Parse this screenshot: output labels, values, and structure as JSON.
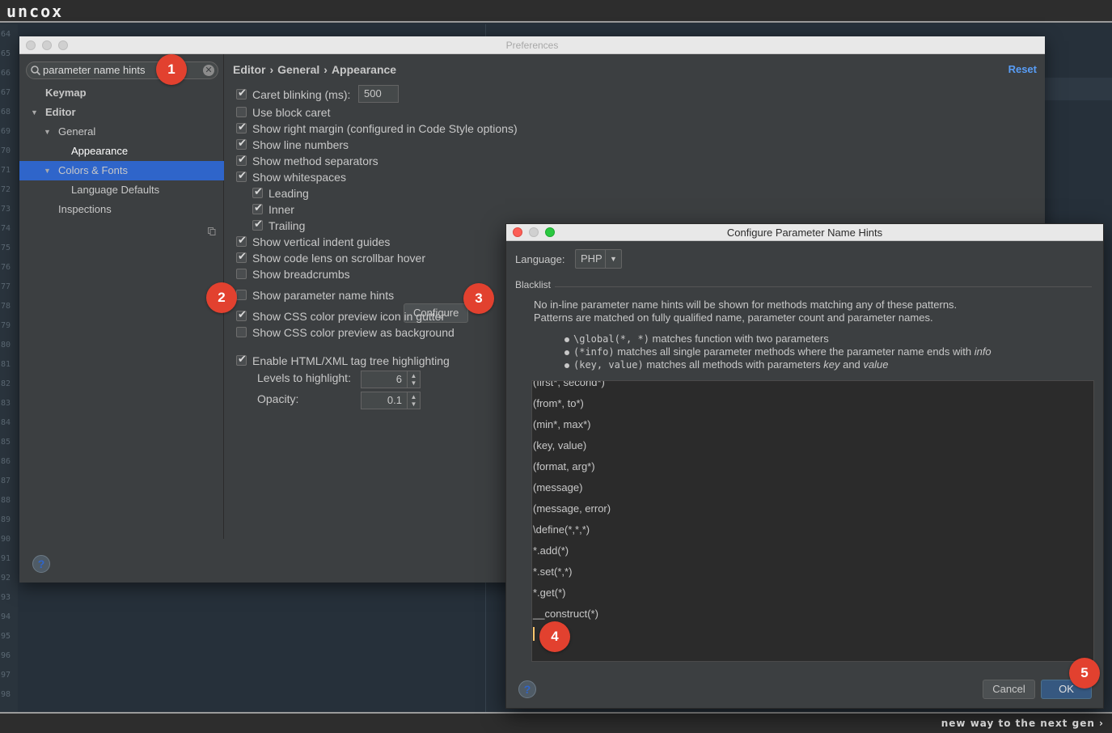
{
  "brand": "uncox",
  "tagline": "new way to the next gen",
  "gutter_lines": [
    "64",
    "65",
    "66",
    "67",
    "68",
    "69",
    "70",
    "71",
    "72",
    "73",
    "74",
    "75",
    "76",
    "77",
    "78",
    "79",
    "80",
    "81",
    "82",
    "83",
    "84",
    "85",
    "86",
    "87",
    "88",
    "89",
    "90",
    "91",
    "92",
    "93",
    "94",
    "95",
    "96",
    "97",
    "98"
  ],
  "preferences": {
    "title": "Preferences",
    "search": {
      "value": "parameter name hints"
    },
    "tree": [
      {
        "label": "Keymap"
      },
      {
        "label": "Editor"
      },
      {
        "label": "General"
      },
      {
        "label": "Appearance"
      },
      {
        "label": "Colors & Fonts"
      },
      {
        "label": "Language Defaults"
      },
      {
        "label": "Inspections"
      }
    ],
    "breadcrumb": [
      "Editor",
      "General",
      "Appearance"
    ],
    "reset_label": "Reset",
    "options": [
      {
        "label": "Caret blinking (ms):",
        "checked": true
      },
      {
        "label": "Use block caret",
        "checked": false
      },
      {
        "label": "Show right margin (configured in Code Style options)",
        "checked": true
      },
      {
        "label": "Show line numbers",
        "checked": true
      },
      {
        "label": "Show method separators",
        "checked": true
      },
      {
        "label": "Show whitespaces",
        "checked": true
      },
      {
        "label": "Leading",
        "checked": true
      },
      {
        "label": "Inner",
        "checked": true
      },
      {
        "label": "Trailing",
        "checked": true
      },
      {
        "label": "Show vertical indent guides",
        "checked": true
      },
      {
        "label": "Show code lens on scrollbar hover",
        "checked": true
      },
      {
        "label": "Show breadcrumbs",
        "checked": false
      },
      {
        "label": "Show parameter name hints",
        "checked": false
      },
      {
        "label": "Show CSS color preview icon in gutter",
        "checked": true
      },
      {
        "label": "Show CSS color preview as background",
        "checked": false
      },
      {
        "label": "Enable HTML/XML tag tree highlighting",
        "checked": true
      }
    ],
    "caret_blinking_value": "500",
    "configure_label": "Configure",
    "levels_label": "Levels to highlight:",
    "levels_value": "6",
    "opacity_label": "Opacity:",
    "opacity_value": "0.1",
    "help_label": "?"
  },
  "dialog": {
    "title": "Configure Parameter Name Hints",
    "language_label": "Language:",
    "language_value": "PHP",
    "blacklist_title": "Blacklist",
    "description": [
      "No in-line parameter name hints will be shown for methods matching any of these patterns.",
      "Patterns are matched on fully qualified name, parameter count and parameter names."
    ],
    "examples": [
      {
        "code": "\\global(*, *)",
        "text": " matches function with two parameters"
      },
      {
        "code": "(*info)",
        "text": " matches all single parameter methods where the parameter name ends with ",
        "em": "info"
      },
      {
        "code": "(key, value)",
        "text": " matches all methods with parameters ",
        "em1": "key",
        "mid": " and ",
        "em2": "value"
      }
    ],
    "patterns": [
      "(first*, second*)",
      "(from*, to*)",
      "(min*, max*)",
      "(key, value)",
      "(format, arg*)",
      "(message)",
      "(message, error)",
      "\\define(*,*,*)",
      "*.add(*)",
      "*.set(*,*)",
      "*.get(*)",
      "__construct(*)"
    ],
    "cancel_label": "Cancel",
    "ok_label": "OK",
    "help_label": "?"
  },
  "badges": [
    "1",
    "2",
    "3",
    "4",
    "5"
  ],
  "colors": {
    "selection": "#2f65ca",
    "badge": "#e2412f",
    "link": "#589df6",
    "ok_button": "#365880"
  }
}
